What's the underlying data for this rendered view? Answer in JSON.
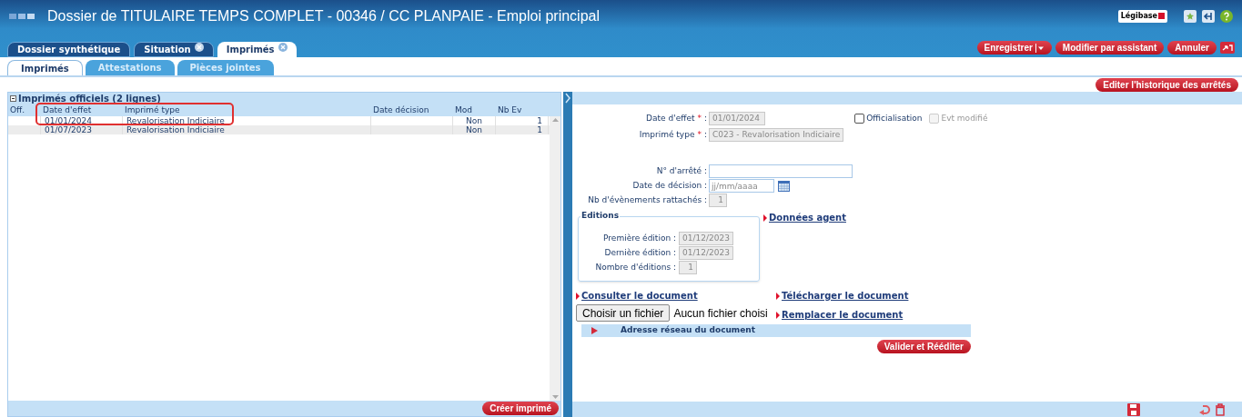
{
  "window": {
    "title": "Dossier de TITULAIRE TEMPS COMPLET - 00346 / CC PLANPAIE - Emploi principal",
    "logo": "Légibase"
  },
  "tabs": [
    {
      "label": "Dossier synthétique",
      "selected": false,
      "closable": false
    },
    {
      "label": "Situation",
      "selected": false,
      "closable": true
    },
    {
      "label": "Imprimés",
      "selected": true,
      "closable": true
    }
  ],
  "toolbar": {
    "buttons": [
      "Enregistrer",
      "Modifier par assistant",
      "Annuler"
    ]
  },
  "subtabs": [
    {
      "label": "Imprimés",
      "selected": true
    },
    {
      "label": "Attestations",
      "selected": false
    },
    {
      "label": "Pièces jointes",
      "selected": false
    }
  ],
  "history_button": "Editer l'historique des arrêtés",
  "list": {
    "title": "Imprimés officiels (2 lignes)",
    "columns": [
      "Off.",
      "Date d'effet",
      "Imprimé type",
      "Date décision",
      "Mod",
      "Nb Ev"
    ],
    "rows": [
      {
        "cells": [
          "",
          "01/01/2024",
          "Revalorisation Indiciaire",
          "",
          "Non",
          "1"
        ],
        "selected": false
      },
      {
        "cells": [
          "",
          "01/07/2023",
          "Revalorisation Indiciaire",
          "",
          "Non",
          "1"
        ],
        "selected": false
      }
    ],
    "create_button": "Créer imprimé"
  },
  "form": {
    "date_effet": {
      "label": "Date d'effet",
      "required_mark": "*",
      "separator": ":",
      "value": "01/01/2024"
    },
    "imprime_type": {
      "label": "Imprimé type",
      "required_mark": "*",
      "separator": ":",
      "value": "C023 - Revalorisation Indiciaire"
    },
    "officialisation": {
      "label": "Officialisation",
      "checked": false
    },
    "evt_modifie": {
      "label": "Evt modifié",
      "checked": false,
      "disabled": true
    },
    "arrete": {
      "label": "N° d'arrêté :"
    },
    "date_decision": {
      "label": "Date de décision :",
      "placeholder": "jj/mm/aaaa"
    },
    "nb_evenements": {
      "label": "Nb d'évènements rattachés :",
      "value": "1"
    },
    "editions": {
      "title": "Editions",
      "fields": [
        {
          "label": "Première édition :",
          "value": "01/12/2023"
        },
        {
          "label": "Dernière édition :",
          "value": "01/12/2023"
        },
        {
          "label": "Nombre d'éditions :",
          "value": "1"
        }
      ]
    },
    "donnees_agent": "Données agent",
    "consulter": "Consulter le document",
    "telecharger": "Télécharger le document",
    "remplacer": "Remplacer le document",
    "file_button": "Choisir un fichier",
    "file_status": "Aucun fichier choisi",
    "adresse": "Adresse réseau du document",
    "valider": "Valider et Rééditer"
  }
}
